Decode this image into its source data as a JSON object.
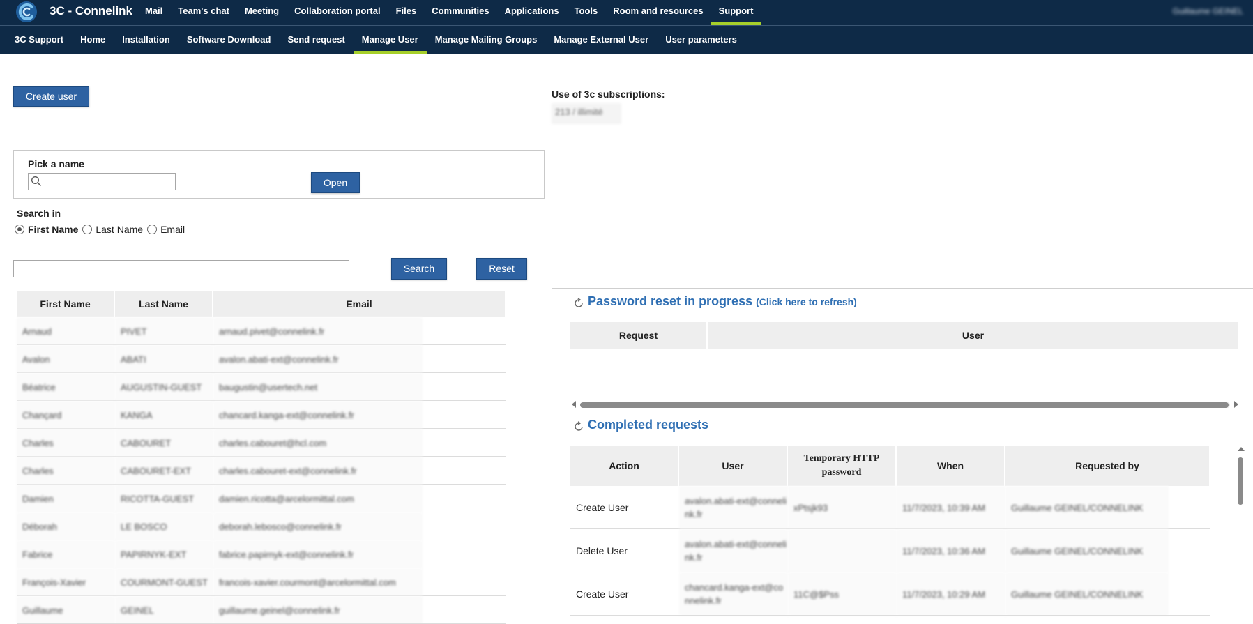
{
  "app": {
    "brand": "3C - Connelink",
    "username": "Guillaume GEINEL"
  },
  "topnav": [
    {
      "label": "Mail",
      "active": false
    },
    {
      "label": "Team's chat",
      "active": false
    },
    {
      "label": "Meeting",
      "active": false
    },
    {
      "label": "Collaboration portal",
      "active": false
    },
    {
      "label": "Files",
      "active": false
    },
    {
      "label": "Communities",
      "active": false
    },
    {
      "label": "Applications",
      "active": false
    },
    {
      "label": "Tools",
      "active": false
    },
    {
      "label": "Room and resources",
      "active": false
    },
    {
      "label": "Support",
      "active": true
    }
  ],
  "subnav": [
    {
      "label": "3C Support",
      "active": false
    },
    {
      "label": "Home",
      "active": false
    },
    {
      "label": "Installation",
      "active": false
    },
    {
      "label": "Software Download",
      "active": false
    },
    {
      "label": "Send request",
      "active": false
    },
    {
      "label": "Manage User",
      "active": true
    },
    {
      "label": "Manage Mailing Groups",
      "active": false
    },
    {
      "label": "Manage External User",
      "active": false
    },
    {
      "label": "User parameters",
      "active": false
    }
  ],
  "create_user_label": "Create user",
  "pick": {
    "label": "Pick a name",
    "value": "",
    "open_label": "Open"
  },
  "search_in": {
    "label": "Search in",
    "options": [
      "First Name",
      "Last Name",
      "Email"
    ],
    "selected": "First Name"
  },
  "search": {
    "value": "",
    "search_label": "Search",
    "reset_label": "Reset"
  },
  "users_table": {
    "headers": [
      "First Name",
      "Last Name",
      "Email"
    ],
    "rows": [
      [
        "Arnaud",
        "PIVET",
        "arnaud.pivet@connelink.fr"
      ],
      [
        "Avalon",
        "ABATI",
        "avalon.abati-ext@connelink.fr"
      ],
      [
        "Béatrice",
        "AUGUSTIN-GUEST",
        "baugustin@usertech.net"
      ],
      [
        "Chançard",
        "KANGA",
        "chancard.kanga-ext@connelink.fr"
      ],
      [
        "Charles",
        "CABOURET",
        "charles.cabouret@hcl.com"
      ],
      [
        "Charles",
        "CABOURET-EXT",
        "charles.cabouret-ext@connelink.fr"
      ],
      [
        "Damien",
        "RICOTTA-GUEST",
        "damien.ricotta@arcelormittal.com"
      ],
      [
        "Déborah",
        "LE BOSCO",
        "deborah.lebosco@connelink.fr"
      ],
      [
        "Fabrice",
        "PAPIRNYK-EXT",
        "fabrice.papirnyk-ext@connelink.fr"
      ],
      [
        "François-Xavier",
        "COURMONT-GUEST",
        "francois-xavier.courmont@arcelormittal.com"
      ],
      [
        "Guillaume",
        "GEINEL",
        "guillaume.geinel@connelink.fr"
      ]
    ]
  },
  "subscriptions": {
    "label": "Use of 3c subscriptions:",
    "value": "213 / illimité"
  },
  "password_reset": {
    "title": "Password reset in progress",
    "refresh_label": "(Click here to refresh)",
    "headers": [
      "Request",
      "User"
    ]
  },
  "completed": {
    "title": "Completed requests",
    "headers": [
      "Action",
      "User",
      "Temporary HTTP password",
      "When",
      "Requested by"
    ],
    "rows": [
      [
        "Create User",
        "avalon.abati-ext@connelink.fr",
        "xPtsjk93",
        "11/7/2023, 10:39 AM",
        "Guillaume GEINEL/CONNELINK"
      ],
      [
        "Delete User",
        "avalon.abati-ext@connelink.fr",
        "",
        "11/7/2023, 10:36 AM",
        "Guillaume GEINEL/CONNELINK"
      ],
      [
        "Create User",
        "chancard.kanga-ext@connelink.fr",
        "11C@$Pss",
        "11/7/2023, 10:29 AM",
        "Guillaume GEINEL/CONNELINK"
      ]
    ]
  },
  "colors": {
    "nav_bg": "#0e2a47",
    "accent": "#a6cf2a",
    "button": "#2e62a2",
    "section_title": "#2f6fb3"
  },
  "icons": {
    "logo": "connelink-logo-icon",
    "search": "search-icon",
    "refresh": "refresh-icon"
  }
}
